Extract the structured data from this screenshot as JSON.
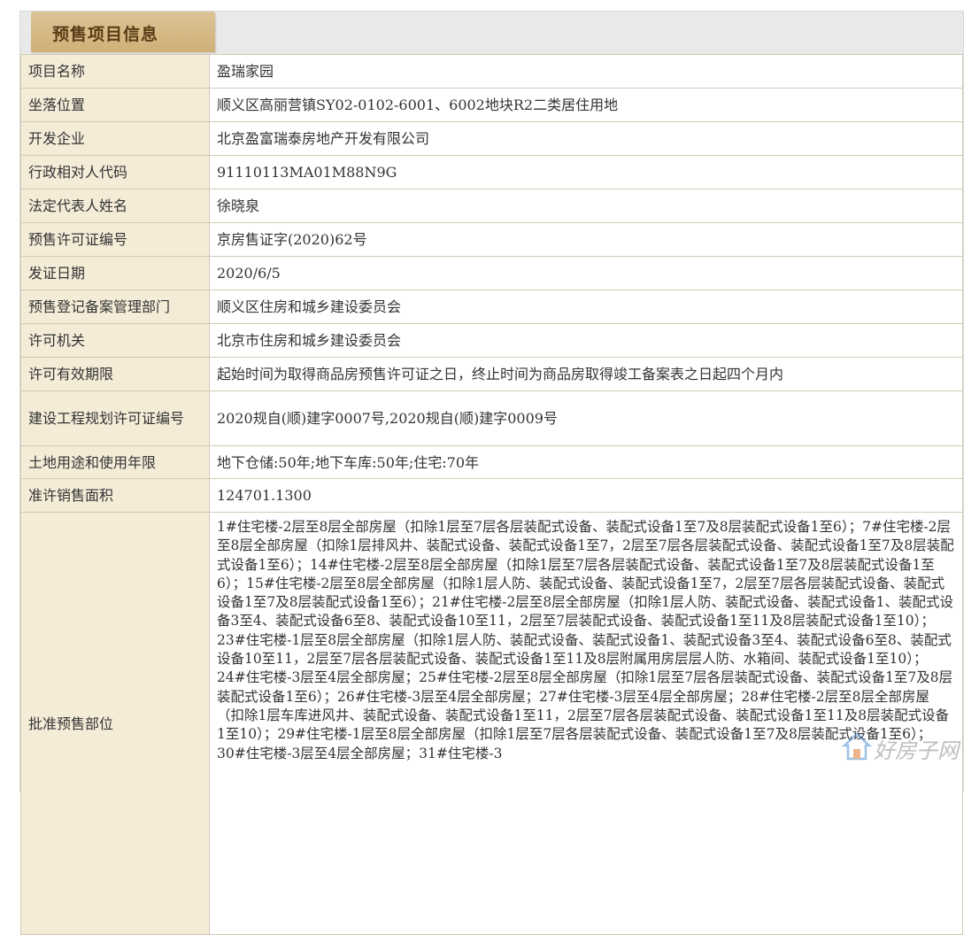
{
  "section": {
    "title": "预售项目信息"
  },
  "rows": [
    {
      "label": "项目名称",
      "value": "盈瑞家园"
    },
    {
      "label": "坐落位置",
      "value": "顺义区高丽营镇SY02-0102-6001、6002地块R2二类居住用地"
    },
    {
      "label": "开发企业",
      "value": "北京盈富瑞泰房地产开发有限公司"
    },
    {
      "label": "行政相对人代码",
      "value": "91110113MA01M88N9G"
    },
    {
      "label": "法定代表人姓名",
      "value": "徐晓泉"
    },
    {
      "label": "预售许可证编号",
      "value": "京房售证字(2020)62号"
    },
    {
      "label": "发证日期",
      "value": "2020/6/5"
    },
    {
      "label": "预售登记备案管理部门",
      "value": "顺义区住房和城乡建设委员会"
    },
    {
      "label": "许可机关",
      "value": "北京市住房和城乡建设委员会"
    },
    {
      "label": "许可有效期限",
      "value": "起始时间为取得商品房预售许可证之日，终止时间为商品房取得竣工备案表之日起四个月内"
    },
    {
      "label": "建设工程规划许可证编号",
      "value": "2020规自(顺)建字0007号,2020规自(顺)建字0009号"
    },
    {
      "label": "土地用途和使用年限",
      "value": "地下仓储:50年;地下车库:50年;住宅:70年"
    },
    {
      "label": "准许销售面积",
      "value": "124701.1300"
    },
    {
      "label": "批准预售部位",
      "value": "1#住宅楼-2层至8层全部房屋（扣除1层至7层各层装配式设备、装配式设备1至7及8层装配式设备1至6）；7#住宅楼-2层至8层全部房屋（扣除1层排风井、装配式设备、装配式设备1至7，2层至7层各层装配式设备、装配式设备1至7及8层装配式设备1至6）；14#住宅楼-2层至8层全部房屋（扣除1层至7层各层装配式设备、装配式设备1至7及8层装配式设备1至6）；15#住宅楼-2层至8层全部房屋（扣除1层人防、装配式设备、装配式设备1至7，2层至7层各层装配式设备、装配式设备1至7及8层装配式设备1至6）；21#住宅楼-2层至8层全部房屋（扣除1层人防、装配式设备、装配式设备1、装配式设备3至4、装配式设备6至8、装配式设备10至11，2层至7层装配式设备、装配式设备1至11及8层装配式设备1至10）；23#住宅楼-1层至8层全部房屋（扣除1层人防、装配式设备、装配式设备1、装配式设备3至4、装配式设备6至8、装配式设备10至11，2层至7层各层装配式设备、装配式设备1至11及8层附属用房层层人防、水箱间、装配式设备1至10）；24#住宅楼-3层至4层全部房屋；25#住宅楼-2层至8层全部房屋（扣除1层至7层各层装配式设备、装配式设备1至7及8层装配式设备1至6）；26#住宅楼-3层至4层全部房屋；27#住宅楼-3层至4层全部房屋；28#住宅楼-2层至8层全部房屋（扣除1层车库进风井、装配式设备、装配式设备1至11，2层至7层各层装配式设备、装配式设备1至11及8层装配式设备1至10）；29#住宅楼-1层至8层全部房屋（扣除1层至7层各层装配式设备、装配式设备1至7及8层装配式设备1至6）；30#住宅楼-3层至4层全部房屋；31#住宅楼-3"
    }
  ],
  "watermark": {
    "text": "好房子网"
  },
  "colors": {
    "header_tab": "#d4b57c",
    "label_bg": "#f5ecd8",
    "border": "#d3c9b6"
  }
}
